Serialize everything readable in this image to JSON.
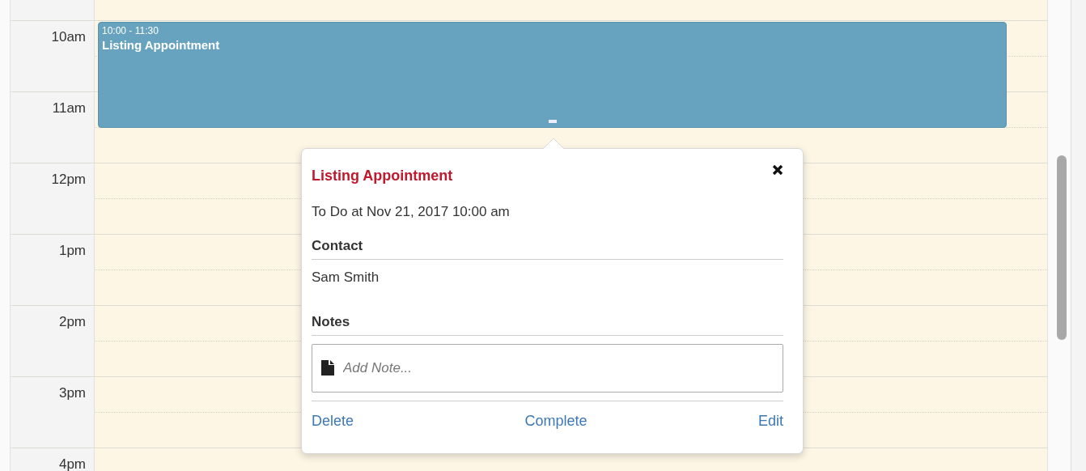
{
  "hours": [
    "10am",
    "11am",
    "12pm",
    "1pm",
    "2pm",
    "3pm",
    "4pm"
  ],
  "event": {
    "time": "10:00 - 11:30",
    "title": "Listing Appointment"
  },
  "popover": {
    "title": "Listing Appointment",
    "when": "To Do at Nov 21, 2017 10:00 am",
    "contact": {
      "heading": "Contact",
      "name": "Sam Smith"
    },
    "notes": {
      "heading": "Notes",
      "placeholder": "Add Note..."
    },
    "actions": [
      "Delete",
      "Complete",
      "Edit"
    ]
  }
}
